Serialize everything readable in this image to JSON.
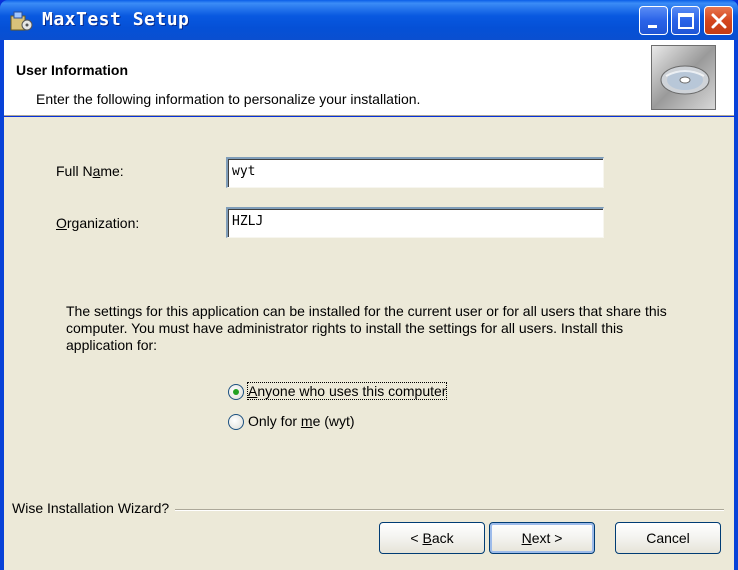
{
  "window": {
    "title": "MaxTest Setup",
    "icons": [
      "installer-icon",
      "minimize-icon",
      "maximize-icon",
      "close-icon"
    ]
  },
  "banner": {
    "title": "User Information",
    "subtitle": "Enter the following information to personalize your installation.",
    "icon": "cd-icon"
  },
  "form": {
    "full_name_label_pre": "Full N",
    "full_name_label_ul": "a",
    "full_name_label_post": "me:",
    "full_name_value": "wyt",
    "org_label_ul": "O",
    "org_label_post": "rganization:",
    "org_value": "HZLJ"
  },
  "install_scope": {
    "description": "The settings for this application can be installed for the current user or for all users that share this computer. You must have administrator rights to install the settings for all users. Install this application for:",
    "options": [
      {
        "label_ul": "A",
        "label_post": "nyone who uses this computer",
        "selected": true
      },
      {
        "label_pre": "Only for ",
        "label_ul": "m",
        "label_post": "e (wyt)",
        "selected": false
      }
    ]
  },
  "footer": {
    "brand": "Wise Installation Wizard?",
    "back_pre": "< ",
    "back_ul": "B",
    "back_post": "ack",
    "next_ul": "N",
    "next_post": "ext >",
    "cancel": "Cancel"
  },
  "colors": {
    "titlebar": "#0858e0",
    "face": "#ece9d8",
    "radio_dot": "#21a121",
    "close_button": "#d4461e"
  }
}
